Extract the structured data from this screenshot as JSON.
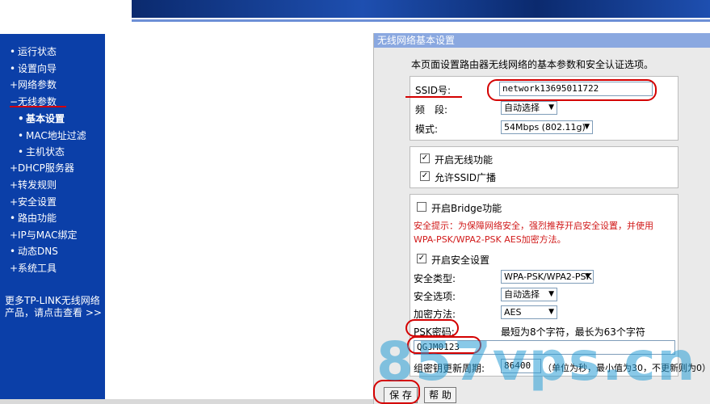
{
  "sidebar": {
    "items": [
      {
        "prefix": "•",
        "label": "运行状态"
      },
      {
        "prefix": "•",
        "label": "设置向导"
      },
      {
        "prefix": "+",
        "label": "网络参数"
      },
      {
        "prefix": "−",
        "label": "无线参数"
      },
      {
        "prefix": "•",
        "label": "基本设置"
      },
      {
        "prefix": "•",
        "label": "MAC地址过滤"
      },
      {
        "prefix": "•",
        "label": "主机状态"
      },
      {
        "prefix": "+",
        "label": "DHCP服务器"
      },
      {
        "prefix": "+",
        "label": "转发规则"
      },
      {
        "prefix": "+",
        "label": "安全设置"
      },
      {
        "prefix": "•",
        "label": "路由功能"
      },
      {
        "prefix": "+",
        "label": "IP与MAC绑定"
      },
      {
        "prefix": "•",
        "label": "动态DNS"
      },
      {
        "prefix": "+",
        "label": "系统工具"
      }
    ],
    "promo_line1": "更多TP-LINK无线网络",
    "promo_line2": "产品，请点击查看 >>"
  },
  "panel": {
    "title": "无线网络基本设置",
    "description": "本页面设置路由器无线网络的基本参数和安全认证选项。",
    "ssid_label": "SSID号:",
    "ssid_value": "network13695011722",
    "band_label": "频　段:",
    "band_value": "自动选择",
    "mode_label": "模式:",
    "mode_value": "54Mbps (802.11g)",
    "enable_wireless": "开启无线功能",
    "allow_ssid_broadcast": "允许SSID广播",
    "enable_bridge": "开启Bridge功能",
    "security_warning_line1": "安全提示：为保障网络安全，强烈推荐开启安全设置，并使用",
    "security_warning_line2": "WPA-PSK/WPA2-PSK AES加密方法。",
    "enable_security": "开启安全设置",
    "security_type_label": "安全类型:",
    "security_type_value": "WPA-PSK/WPA2-PSK",
    "security_option_label": "安全选项:",
    "security_option_value": "自动选择",
    "encryption_label": "加密方法:",
    "encryption_value": "AES",
    "psk_label": "PSK密码:",
    "psk_hint": "最短为8个字符，最长为63个字符",
    "psk_value": "QGJM0123",
    "rekey_label": "组密钥更新周期:",
    "rekey_value": "86400",
    "rekey_hint": "（单位为秒，最小值为30，不更新则为0）",
    "save_button": "保 存",
    "help_button": "帮 助",
    "checkmark": "✓",
    "dropdown_arrow": "▼"
  },
  "watermark": "857vps.cn",
  "colors": {
    "sidebar_bg": "#0b3fa8",
    "panel_title_bg": "#8aa8e0",
    "annotation_red": "#d40000",
    "warning_red": "#d11a1a"
  }
}
